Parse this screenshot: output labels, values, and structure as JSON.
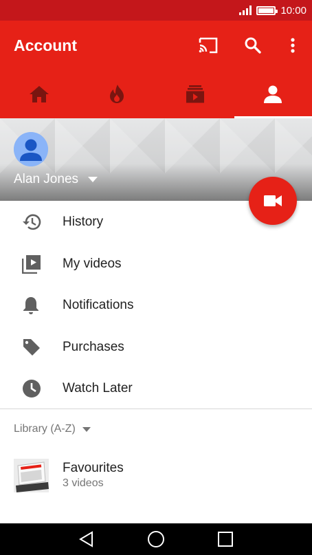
{
  "status_bar": {
    "time": "10:00",
    "icons": [
      "signal-icon",
      "battery-icon"
    ]
  },
  "app_bar": {
    "title": "Account",
    "actions": [
      "cast-icon",
      "search-icon",
      "more-vert-icon"
    ]
  },
  "tabs": [
    {
      "icon": "home-icon",
      "active": false
    },
    {
      "icon": "trending-icon",
      "active": false
    },
    {
      "icon": "subscriptions-icon",
      "active": false
    },
    {
      "icon": "account-icon",
      "active": true
    }
  ],
  "account": {
    "name": "Alan Jones",
    "avatar_icon": "avatar-icon"
  },
  "fab": {
    "icon": "video-camera-icon"
  },
  "menu": {
    "items": [
      {
        "label": "History",
        "icon": "history-icon"
      },
      {
        "label": "My videos",
        "icon": "my-videos-icon"
      },
      {
        "label": "Notifications",
        "icon": "bell-icon"
      },
      {
        "label": "Purchases",
        "icon": "tag-icon"
      },
      {
        "label": "Watch Later",
        "icon": "clock-icon"
      }
    ]
  },
  "library": {
    "label": "Library (A-Z)",
    "playlists": [
      {
        "title": "Favourites",
        "count": "3 videos"
      }
    ]
  },
  "nav_bar": {
    "buttons": [
      "back-icon",
      "home-circle-icon",
      "recents-icon"
    ]
  },
  "colors": {
    "status_bar": "#c4171b",
    "brand_red": "#e62117",
    "text_primary": "#212121",
    "text_secondary": "#757575",
    "icon_grey": "#606060"
  }
}
